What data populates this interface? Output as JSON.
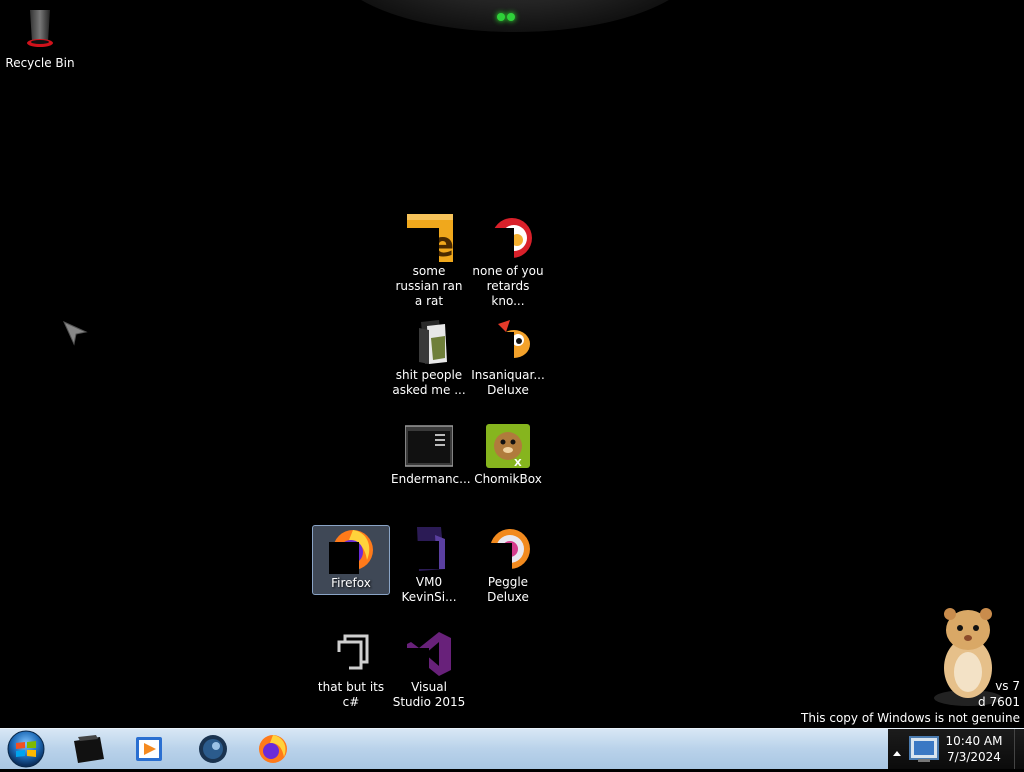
{
  "desktop": {
    "icons": [
      {
        "label": "Recycle Bin",
        "icon": "recycle-bin-icon"
      },
      {
        "label": "some russian ran a rat",
        "icon": "script-file-icon"
      },
      {
        "label": "none of you retards kno...",
        "icon": "zuma-app-icon"
      },
      {
        "label": "shit people asked me ...",
        "icon": "folder-icon"
      },
      {
        "label": "Insaniquar... Deluxe",
        "icon": "insaniquarium-icon"
      },
      {
        "label": "Endermanc...",
        "icon": "terminal-window-icon"
      },
      {
        "label": "ChomikBox",
        "icon": "chomikbox-icon"
      },
      {
        "label": "Firefox",
        "icon": "firefox-icon"
      },
      {
        "label": "VM0 KevinSi...",
        "icon": "vm-file-icon"
      },
      {
        "label": "Peggle Deluxe",
        "icon": "peggle-icon"
      },
      {
        "label": "that but its c#",
        "icon": "shortcut-stack-icon"
      },
      {
        "label": "Visual Studio 2015",
        "icon": "visual-studio-icon"
      }
    ]
  },
  "watermark": {
    "line1": "vs 7",
    "line2": "d 7601",
    "line3": "This copy of Windows is not genuine"
  },
  "taskbar": {
    "pinned": [
      {
        "name": "explorer",
        "icon": "explorer-icon"
      },
      {
        "name": "media player",
        "icon": "media-player-icon"
      },
      {
        "name": "steam",
        "icon": "steam-icon"
      },
      {
        "name": "firefox",
        "icon": "firefox-icon"
      }
    ],
    "clock": {
      "time": "10:40 AM",
      "date": "7/3/2024"
    }
  },
  "colors": {
    "taskbar": "#b9d2ea",
    "tray": "#111111",
    "selection": "#8aa4c6"
  }
}
